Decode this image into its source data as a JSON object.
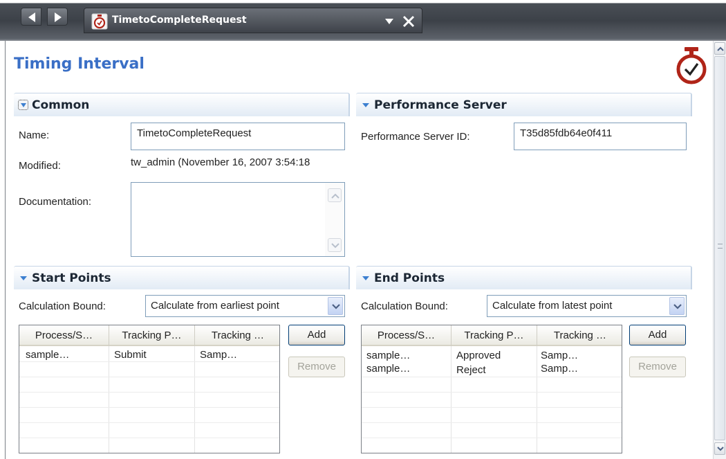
{
  "window": {
    "tab_title": "TimetoCompleteRequest"
  },
  "page": {
    "title": "Timing Interval"
  },
  "common": {
    "header": "Common",
    "name_label": "Name:",
    "name_value": "TimetoCompleteRequest",
    "modified_label": "Modified:",
    "modified_value": "tw_admin (November 16, 2007 3:54:18",
    "documentation_label": "Documentation:",
    "documentation_value": ""
  },
  "performance_server": {
    "header": "Performance Server",
    "id_label": "Performance Server ID:",
    "id_value": "T35d85fdb64e0f411"
  },
  "start_points": {
    "header": "Start Points",
    "bound_label": "Calculation Bound:",
    "bound_value": "Calculate from earliest point",
    "columns": [
      "Process/S…",
      "Tracking P…",
      "Tracking …"
    ],
    "rows": [
      [
        "sample…",
        "Submit",
        "Samp…"
      ]
    ],
    "add_label": "Add",
    "remove_label": "Remove"
  },
  "end_points": {
    "header": "End Points",
    "bound_label": "Calculation Bound:",
    "bound_value": "Calculate from latest point",
    "columns": [
      "Process/S…",
      "Tracking P…",
      "Tracking …"
    ],
    "rows": [
      [
        "sample…",
        "Approved",
        "Samp…"
      ],
      [
        "sample…",
        "Reject",
        "Samp…"
      ]
    ],
    "add_label": "Add",
    "remove_label": "Remove"
  },
  "colors": {
    "title_blue": "#3a6fc6",
    "timer_red": "#b02418",
    "section_triangle": "#3c7fd0"
  },
  "icons": {
    "back": "back-arrow-icon",
    "forward": "forward-arrow-icon",
    "timer": "stopwatch-icon",
    "menu": "dropdown-triangle-icon",
    "close": "close-icon"
  }
}
